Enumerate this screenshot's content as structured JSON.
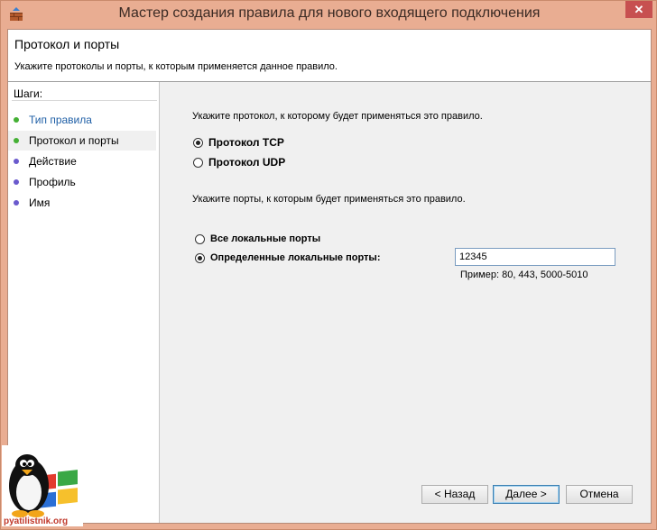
{
  "window": {
    "title": "Мастер создания правила для нового входящего подключения",
    "close_label": "✕"
  },
  "header": {
    "title": "Протокол и порты",
    "description": "Укажите протоколы и порты, к которым применяется данное правило."
  },
  "steps": {
    "title": "Шаги:",
    "items": [
      {
        "label": "Тип правила",
        "color": "#44b034",
        "link_color": "#1f5fa6"
      },
      {
        "label": "Протокол и порты",
        "color": "#44b034",
        "link_color": "#000000"
      },
      {
        "label": "Действие",
        "color": "#6a5acd",
        "link_color": "#000000"
      },
      {
        "label": "Профиль",
        "color": "#6a5acd",
        "link_color": "#000000"
      },
      {
        "label": "Имя",
        "color": "#6a5acd",
        "link_color": "#000000"
      }
    ]
  },
  "protocol": {
    "prompt": "Укажите протокол, к которому будет применяться это правило.",
    "tcp_label": "Протокол TCP",
    "udp_label": "Протокол UDP",
    "selected": "tcp"
  },
  "ports": {
    "prompt": "Укажите порты, к которым будет применяться это правило.",
    "all_label": "Все локальные порты",
    "specific_label": "Определенные локальные порты:",
    "selected": "specific",
    "value": "12345",
    "hint": "Пример: 80, 443, 5000-5010"
  },
  "buttons": {
    "back": "< Назад",
    "next": "Далее >",
    "cancel": "Отмена"
  },
  "watermark": {
    "text": "pyatilistnik.org"
  }
}
